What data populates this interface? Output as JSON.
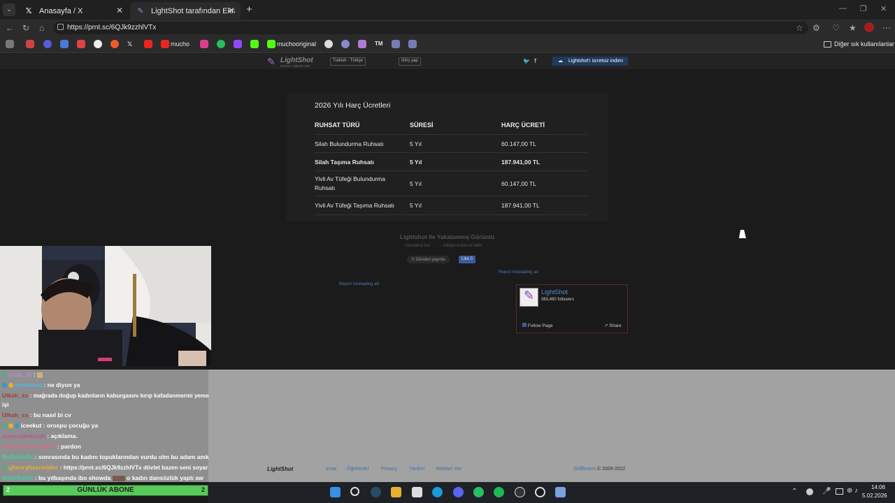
{
  "browser": {
    "tabs": [
      {
        "title": "Anasayfa / X",
        "icon": "x-logo-icon"
      },
      {
        "title": "LightShot tarafından Ekran Görüntüsü",
        "icon": "lightshot-feather-icon"
      }
    ],
    "url": "https://prnt.sc/6QJk9zzhlVTx",
    "bookmarks": {
      "mucho": "mucho",
      "muchooriginal": "muchooriginal",
      "tm": "TM",
      "other": "Diğer sık kullanılanlar"
    }
  },
  "lightshot": {
    "logo": "LightShot",
    "tagline": "screen capture tool",
    "language": "Turkish - Türkçe",
    "login": "Giriş yap",
    "download": "Lightshot'ı ücretsiz indirin",
    "caption": "Lightshot ile Yakalanmış Görüntü",
    "similar": "benzerini bul",
    "abuse": "kötüye kullanım bildir",
    "post": "Gönderi yayınla",
    "like": "Like 0",
    "report_left": "Report misleading ad",
    "report_right": "Report misleading ad",
    "fb": {
      "name": "LightShot",
      "followers": "383,460 followers",
      "follow": "Follow Page",
      "share": "Share"
    },
    "footer": {
      "links": [
        "Insta",
        "Öğreticiler",
        "Privacy",
        "Yardım",
        "Reklam Ver"
      ],
      "copyright_owner": "Skillbrains",
      "copyright_years": "© 2009-2022"
    }
  },
  "fee_table": {
    "title": "2026 Yılı Harç Ücretleri",
    "headers": [
      "RUHSAT TÜRÜ",
      "SÜRESİ",
      "HARÇ ÜCRETİ"
    ],
    "rows": [
      {
        "type": "Silah Bulundurma Ruhsatı",
        "duration": "5 Yıl",
        "fee": "60.147,00 TL"
      },
      {
        "type": "Silah Taşıma Ruhsatı",
        "duration": "5 Yıl",
        "fee": "187.941,00 TL"
      },
      {
        "type_line1": "Yivli Av Tüfeği Bulundurma",
        "type_line2": "Ruhsatı",
        "duration": "5 Yıl",
        "fee": "60.147,00 TL"
      },
      {
        "type": "Yivli Av Tüfeği Taşıma Ruhsatı",
        "duration": "5 Yıl",
        "fee": "187.941,00 TL"
      }
    ]
  },
  "chat": [
    {
      "user": "paşa_02",
      "msg": ":",
      "color": "#b58bd6"
    },
    {
      "user": "ventorout",
      "msg": ": ne diyon ya",
      "color": "#4fb8e8"
    },
    {
      "user": "Ulkah_ss",
      "msg": ": mağrada doğup kadınların kaburgasını kırıp kafadanmermi yeme",
      "msg2": "işi",
      "color": "#a0403a"
    },
    {
      "user": "Ulkah_ss",
      "msg": ": bu nasıl bi cv",
      "color": "#a0403a"
    },
    {
      "user": "iceekut",
      "msg": ": orospu çocuğu ya",
      "color": "#ffffff"
    },
    {
      "user": "zumrutthetrash",
      "msg": ": açıklama.",
      "color": "#c0509a"
    },
    {
      "user": "bubenisinirlendirdi",
      "msg": ": pardon",
      "color": "#d86a8a"
    },
    {
      "user": "BySeKoOo",
      "msg": ": sonrasında bu kadını topuklarından vurdu olm bu adam amk",
      "color": "#3ad4a8"
    },
    {
      "user": "gheorghesneijder",
      "msg": ": https://prnt.sc/6QJk9zzhlVTx dövlet bazen seni soyar",
      "color": "#e6b030"
    },
    {
      "user": "BySeKoOo",
      "msg": ": bu yılbaşında ibo showda",
      "msg_after": "o kadın dansözlük yaptı aw",
      "color": "#3ad4a8"
    }
  ],
  "goal_bar": {
    "left": "2",
    "label": "GÜNLÜK ABONE",
    "right": "2"
  },
  "taskbar": {
    "time": "14:06",
    "date": "5.02.2026"
  }
}
